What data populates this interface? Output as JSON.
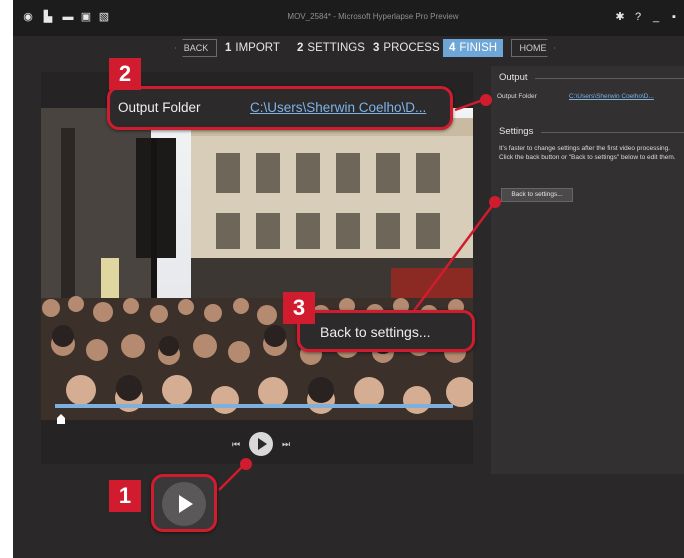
{
  "window": {
    "title": "MOV_2584* - Microsoft Hyperlapse Pro Preview"
  },
  "titlebar": {
    "icons": [
      "gear-icon",
      "help-icon",
      "minimize-icon",
      "close-icon"
    ],
    "help_glyph": "?"
  },
  "nav": {
    "back_label": "BACK",
    "steps": [
      {
        "num": "1",
        "label": "IMPORT"
      },
      {
        "num": "2",
        "label": "SETTINGS"
      },
      {
        "num": "3",
        "label": "PROCESS"
      },
      {
        "num": "4",
        "label": "FINISH"
      }
    ],
    "home_label": "HOME",
    "active_step": "4"
  },
  "sidebar": {
    "output_heading": "Output",
    "output_folder_label": "Output Folder",
    "output_folder_value": "C:\\Users\\Sherwin Coelho\\D...",
    "settings_heading": "Settings",
    "settings_text": "It's faster to change settings after the first video processing. Click the back button or \"Back to settings\" below to edit them.",
    "back_to_settings": "Back to settings..."
  },
  "player": {
    "seek_progress": 0.0
  },
  "callouts": {
    "c1": {
      "badge": "1"
    },
    "c2": {
      "badge": "2",
      "label": "Output Folder",
      "value": "C:\\Users\\Sherwin Coelho\\D..."
    },
    "c3": {
      "badge": "3",
      "label": "Back to settings..."
    }
  },
  "colors": {
    "accent": "#6fa6d8",
    "callout_red": "#d01c2e",
    "link": "#7fb3e8"
  }
}
